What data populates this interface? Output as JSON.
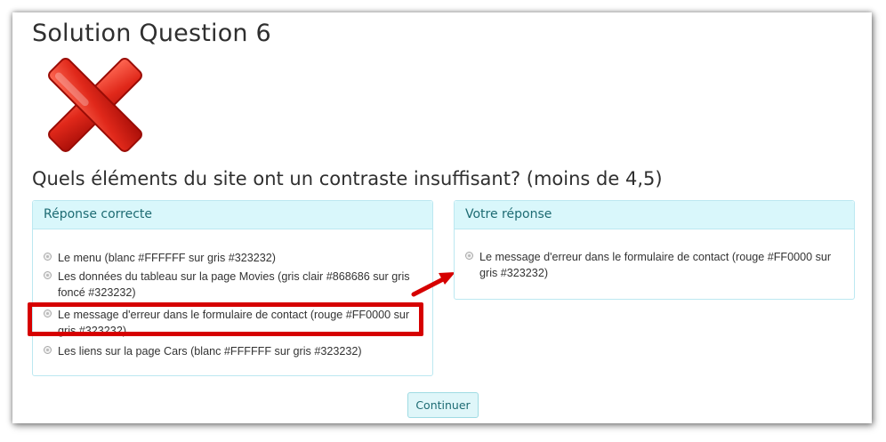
{
  "page": {
    "title": "Solution Question 6",
    "result_icon": "red-cross-icon"
  },
  "question": {
    "text": "Quels éléments du site ont un contraste insuffisant? (moins de 4,5)"
  },
  "correct_panel": {
    "header": "Réponse correcte",
    "options": [
      {
        "label": "Le menu (blanc #FFFFFF sur gris #323232)"
      },
      {
        "label": "Les données du tableau sur la page Movies (gris clair #868686 sur gris foncé #323232)"
      },
      {
        "label": "Le message d'erreur dans le formulaire de contact (rouge #FF0000 sur gris #323232)",
        "highlighted": true
      },
      {
        "label": "Les liens sur la page Cars (blanc #FFFFFF sur gris #323232)"
      }
    ]
  },
  "your_panel": {
    "header": "Votre réponse",
    "options": [
      {
        "label": "Le message d'erreur dans le formulaire de contact (rouge #FF0000 sur gris #323232)"
      }
    ]
  },
  "actions": {
    "continue_label": "Continuer"
  },
  "colors": {
    "panel_header_bg": "#d9f7fb",
    "panel_border": "#bce8f1",
    "panel_header_text": "#1d6b73",
    "highlight": "#d60000"
  }
}
